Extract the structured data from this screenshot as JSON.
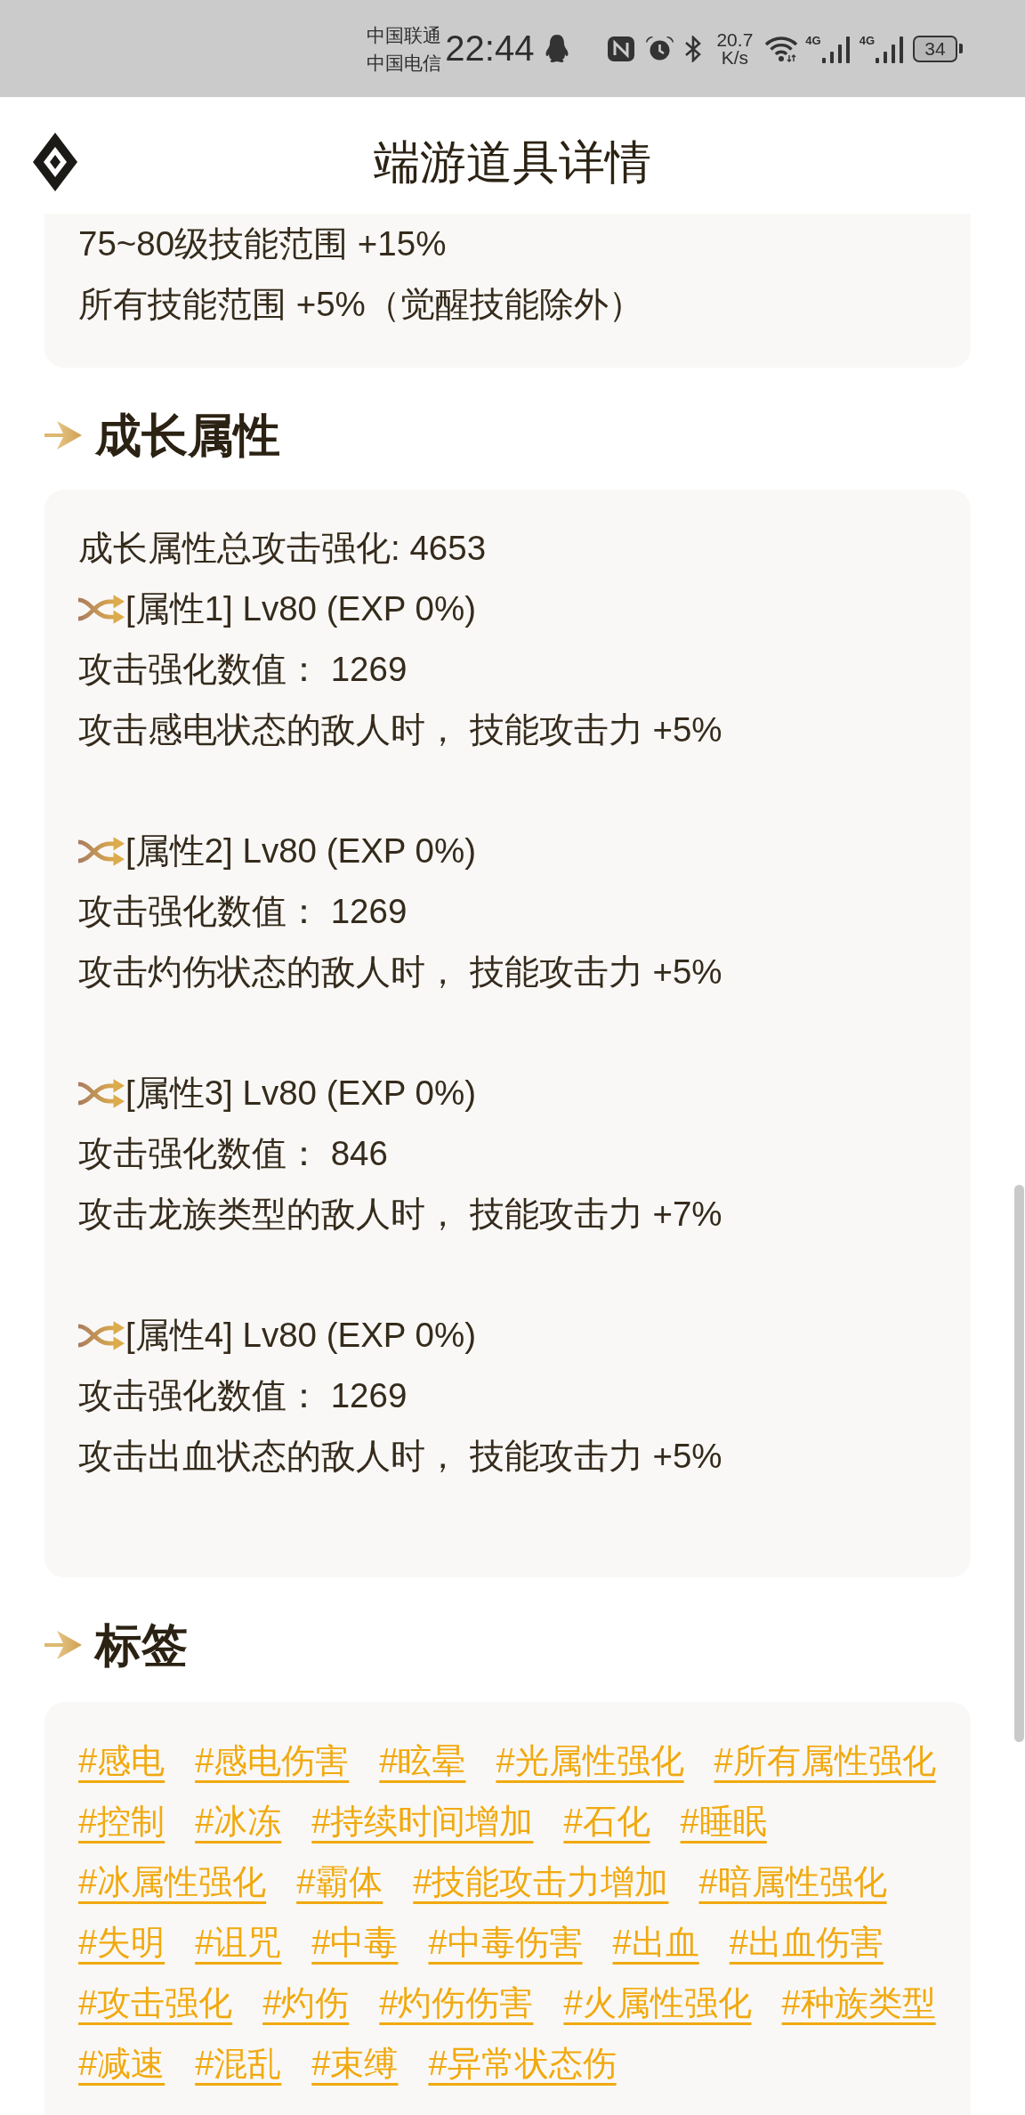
{
  "status_bar": {
    "carriers": [
      "中国联通",
      "中国电信"
    ],
    "time": "22:44",
    "network_speed": {
      "value": "20.7",
      "unit": "K/s"
    },
    "signals": [
      {
        "network": "4G"
      },
      {
        "network": "4G"
      }
    ],
    "battery": {
      "label": "34"
    }
  },
  "header": {
    "title": "端游道具详情"
  },
  "effects_card": {
    "lines": [
      "75~80级技能范围 +15%",
      "所有技能范围 +5%（觉醒技能除外）"
    ]
  },
  "growth_section": {
    "heading": "成长属性",
    "summary": "成长属性总攻击强化: 4653",
    "attributes": [
      {
        "title": "[属性1] Lv80 (EXP 0%)",
        "value_line": "攻击强化数值： 1269",
        "effect": "攻击感电状态的敌人时， 技能攻击力 +5%"
      },
      {
        "title": "[属性2] Lv80 (EXP 0%)",
        "value_line": "攻击强化数值： 1269",
        "effect": "攻击灼伤状态的敌人时， 技能攻击力 +5%"
      },
      {
        "title": "[属性3] Lv80 (EXP 0%)",
        "value_line": "攻击强化数值： 846",
        "effect": "攻击龙族类型的敌人时， 技能攻击力 +7%"
      },
      {
        "title": "[属性4] Lv80 (EXP 0%)",
        "value_line": "攻击强化数值： 1269",
        "effect": "攻击出血状态的敌人时， 技能攻击力 +5%"
      }
    ]
  },
  "tags_section": {
    "heading": "标签",
    "tags": [
      "#感电",
      "#感电伤害",
      "#眩晕",
      "#光属性强化",
      "#所有属性强化",
      "#控制",
      "#冰冻",
      "#持续时间增加",
      "#石化",
      "#睡眠",
      "#冰属性强化",
      "#霸体",
      "#技能攻击力增加",
      "#暗属性强化",
      "#失明",
      "#诅咒",
      "#中毒",
      "#中毒伤害",
      "#出血",
      "#出血伤害",
      "#攻击强化",
      "#灼伤",
      "#灼伤伤害",
      "#火属性强化",
      "#种族类型",
      "#减速",
      "#混乱",
      "#束缚",
      "#异常状态伤"
    ]
  }
}
